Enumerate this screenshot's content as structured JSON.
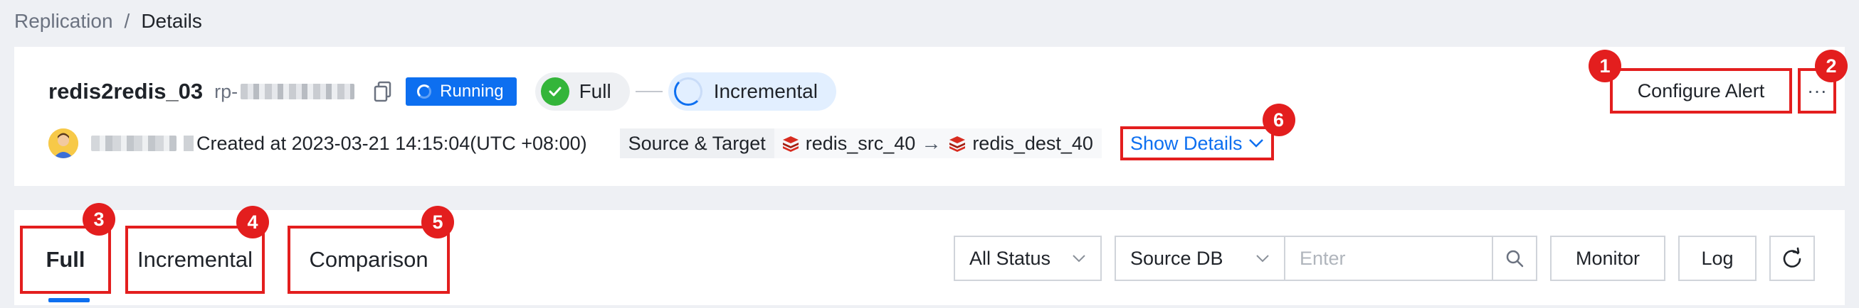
{
  "breadcrumb": {
    "parent": "Replication",
    "separator": "/",
    "current": "Details"
  },
  "task": {
    "name": "redis2redis_03",
    "id_prefix": "rp-",
    "status": "Running",
    "stage_full": "Full",
    "stage_incremental": "Incremental",
    "created_text": "Created at 2023-03-21 14:15:04(UTC +08:00)",
    "source_target_label": "Source & Target",
    "source": "redis_src_40",
    "target": "redis_dest_40",
    "show_details": "Show Details"
  },
  "header_actions": {
    "configure_alert": "Configure Alert",
    "more": "···"
  },
  "annotations": {
    "b1": "1",
    "b2": "2",
    "b3": "3",
    "b4": "4",
    "b5": "5",
    "b6": "6"
  },
  "tabs": {
    "full": "Full",
    "incremental": "Incremental",
    "comparison": "Comparison"
  },
  "toolbar": {
    "status_select": "All Status",
    "db_select": "Source DB",
    "search_placeholder": "Enter",
    "monitor": "Monitor",
    "log": "Log"
  },
  "colors": {
    "accent": "#0d6ff0",
    "annotation": "#e31e1e",
    "success": "#34b53a"
  }
}
